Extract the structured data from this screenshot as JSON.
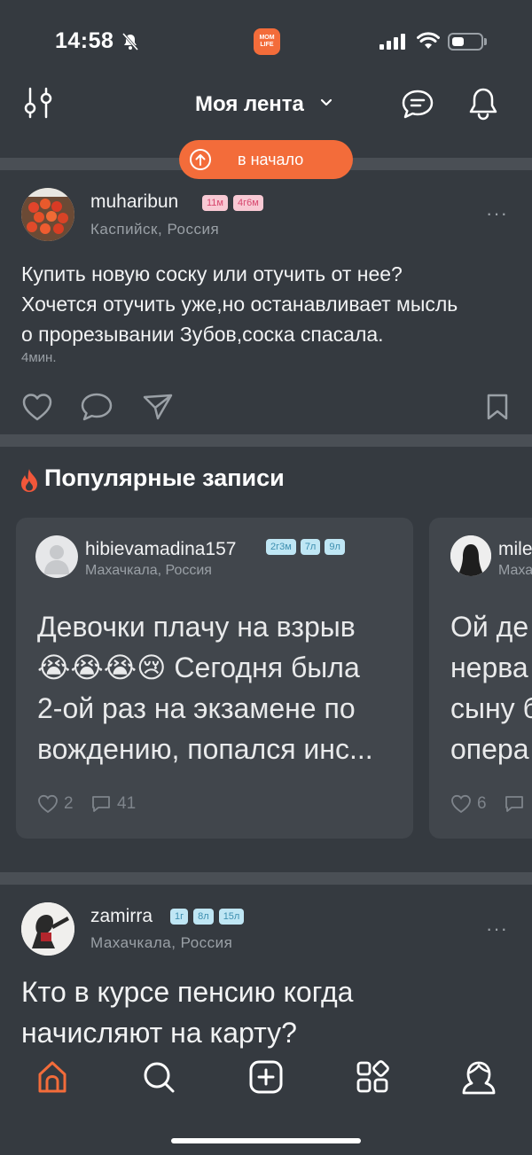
{
  "status_bar": {
    "time": "14:58",
    "app_logo_text": "MOM LIFE"
  },
  "header": {
    "title": "Моя лента"
  },
  "to_top_button": {
    "label": "в начало"
  },
  "post1": {
    "username": "muharibun",
    "badges": [
      "11м",
      "4г6м"
    ],
    "location": "Каспийск, Россия",
    "text_lines": [
      "Купить новую соску или отучить от нее?",
      "Хочется отучить уже,но останавливает мысль",
      "о прорезывании Зубов,соска спасала."
    ],
    "time": "4мин.",
    "more": "···"
  },
  "popular": {
    "title": "Популярные записи",
    "cards": [
      {
        "username": "hibievamadina157",
        "badges": [
          "2г3м",
          "7л",
          "9л"
        ],
        "location": "Махачкала, Россия",
        "text_lines": [
          "Девочки плачу на взрыв",
          "😭😭😭😢 Сегодня была",
          "2-ой раз на экзамене по",
          "вождению, попался инс..."
        ],
        "likes": "2",
        "comments": "41"
      },
      {
        "username": "mile",
        "location": "Маха",
        "text_lines": [
          "Ой де",
          "нерва",
          "сыну б",
          "опера"
        ],
        "likes": "6"
      }
    ]
  },
  "post2": {
    "username": "zamirra",
    "badges": [
      "1г",
      "8л",
      "15л"
    ],
    "location": "Махачкала, Россия",
    "text_lines": [
      "Кто в курсе пенсию когда",
      "начисляют на карту?"
    ],
    "more": "···"
  },
  "colors": {
    "accent": "#f36c3a",
    "background": "#353a40",
    "card": "#41464c",
    "separator": "#4a4f55"
  },
  "nav_icons": [
    "home-icon",
    "search-icon",
    "add-icon",
    "apps-icon",
    "profile-icon"
  ]
}
